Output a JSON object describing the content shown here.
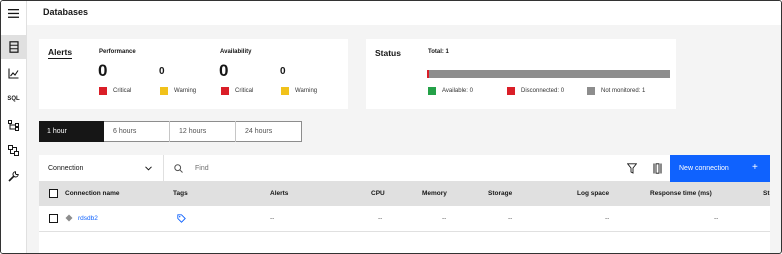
{
  "page": {
    "title": "Databases"
  },
  "nav": {
    "items": [
      {
        "icon": "menu-icon"
      },
      {
        "icon": "database-icon"
      },
      {
        "icon": "chart-icon"
      },
      {
        "icon": "sql-icon",
        "label": "SQL"
      },
      {
        "icon": "tree-icon"
      },
      {
        "icon": "flow-icon"
      },
      {
        "icon": "wrench-icon"
      }
    ]
  },
  "alerts": {
    "title": "Alerts",
    "performance": {
      "label": "Performance",
      "critical": "0",
      "warning": "0",
      "critical_label": "Critical",
      "warning_label": "Warning"
    },
    "availability": {
      "label": "Availability",
      "critical": "0",
      "warning": "0",
      "critical_label": "Critical",
      "warning_label": "Warning"
    }
  },
  "status": {
    "title": "Status",
    "total": "Total: 1",
    "available": 0,
    "disconnected": 0,
    "not_monitored": 1,
    "available_label": "Available: 0",
    "disconnected_label": "Disconnected: 0",
    "not_monitored_label": "Not monitored: 1"
  },
  "time_range": {
    "options": [
      "1 hour",
      "6 hours",
      "12 hours",
      "24 hours"
    ],
    "selected": "1 hour"
  },
  "toolbar": {
    "dropdown_value": "Connection",
    "search_placeholder": "Find",
    "new_connection_label": "New connection"
  },
  "table": {
    "columns": [
      "Connection name",
      "Tags",
      "Alerts",
      "CPU",
      "Memory",
      "Storage",
      "Log space",
      "Response time (ms)",
      "St"
    ],
    "rows": [
      {
        "name": "rdsdb2",
        "alerts": "--",
        "cpu": "--",
        "memory": "--",
        "storage": "--",
        "log_space": "--",
        "response_time": "--",
        "status": "--"
      }
    ]
  },
  "colors": {
    "critical": "#da1e28",
    "warning": "#f1c21b",
    "available": "#24a148",
    "not_monitored": "#8d8d8d",
    "accent": "#0f62fe",
    "selected_tab": "#161616"
  }
}
